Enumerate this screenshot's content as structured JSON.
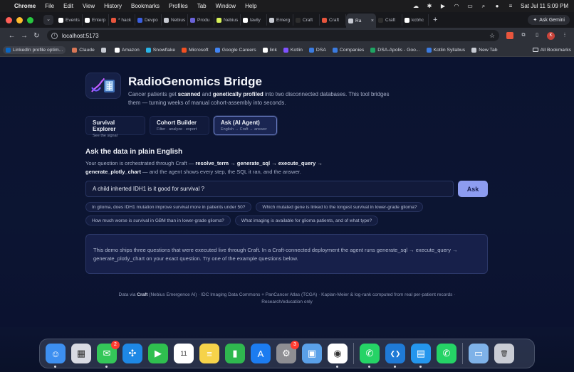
{
  "menubar": {
    "app": "Chrome",
    "items": [
      "File",
      "Edit",
      "View",
      "History",
      "Bookmarks",
      "Profiles",
      "Tab",
      "Window",
      "Help"
    ],
    "clock": "Sat Jul 11  5:09 PM"
  },
  "tabs": [
    {
      "label": "Events",
      "color": "#ffffff"
    },
    {
      "label": "Enterp",
      "color": "#ffffff"
    },
    {
      "label": "* hack",
      "color": "#e8553d"
    },
    {
      "label": "Devpo",
      "color": "#3b5fe0"
    },
    {
      "label": "Nebius",
      "color": "#c8cbd3"
    },
    {
      "label": "Produ",
      "color": "#6b63d9"
    },
    {
      "label": "Nebius",
      "color": "#d7f25a"
    },
    {
      "label": "tavily",
      "color": "#ffffff"
    },
    {
      "label": "Emerg",
      "color": "#c8cbd3"
    },
    {
      "label": "Craft",
      "color": "#2e2e2e"
    },
    {
      "label": "Craft",
      "color": "#e8553d"
    },
    {
      "label": "Ra",
      "color": "#c8cbd3",
      "active": true
    },
    {
      "label": "Craft",
      "color": "#2e2e2e"
    },
    {
      "label": "kcbhc",
      "color": "#ffffff"
    }
  ],
  "ask_gemini": "Ask Gemini",
  "address": {
    "url": "localhost:5173"
  },
  "bookmarks": [
    {
      "label": "LinkedIn profile optim...",
      "color": "#0a66c2"
    },
    {
      "label": "Claude",
      "color": "#d97757"
    },
    {
      "label": "",
      "color": "#c8cbd3"
    },
    {
      "label": "Amazon",
      "color": "#ffffff"
    },
    {
      "label": "Snowflake",
      "color": "#29b5e8"
    },
    {
      "label": "Microsoft",
      "color": "#f25022"
    },
    {
      "label": "Google Careers",
      "color": "#4285f4"
    },
    {
      "label": "link",
      "color": "#ffffff"
    },
    {
      "label": "Kotlin",
      "color": "#7f52ff"
    },
    {
      "label": "DSA",
      "color": "#3b7be0"
    },
    {
      "label": "Companies",
      "color": "#3b7be0"
    },
    {
      "label": "DSA-Apolis - Goo...",
      "color": "#1fa463"
    },
    {
      "label": "Kotlin Syllabus",
      "color": "#3b7be0"
    },
    {
      "label": "New Tab",
      "color": "#c8cbd3"
    }
  ],
  "all_bookmarks": "All Bookmarks",
  "hero": {
    "title": "RadioGenomics Bridge",
    "desc_1": "Cancer patients get ",
    "desc_b1": "scanned",
    "desc_2": " and ",
    "desc_b2": "genetically profiled",
    "desc_3": " into two disconnected databases. This tool bridges them — turning weeks of manual cohort-assembly into seconds."
  },
  "cards": [
    {
      "title": "Survival Explorer",
      "sub": "See the signal"
    },
    {
      "title": "Cohort Builder",
      "sub": "Filter · analyze · export"
    },
    {
      "title": "Ask (AI Agent)",
      "sub": "English → Craft → answer"
    }
  ],
  "ask_section": {
    "title": "Ask the data in plain English",
    "desc_1": "Your question is orchestrated through Craft — ",
    "desc_b1": "resolve_term → generate_sql → execute_query → generate_plotly_chart",
    "desc_2": " — and the agent shows every step, the SQL it ran, and the answer.",
    "query_value": "A child inherted IDH1 is it good for survival ?",
    "ask_label": "Ask"
  },
  "examples": [
    [
      "In glioma, does IDH1 mutation improve survival more in patients under 50?",
      "Which mutated gene is linked to the longest survival in lower-grade glioma?"
    ],
    [
      "How much worse is survival in GBM than in lower-grade glioma?",
      "What imaging is available for glioma patients, and of what type?"
    ]
  ],
  "info_text": "This demo ships three questions that were executed live through Craft. In a Craft-connected deployment the agent runs generate_sql → execute_query → generate_plotly_chart on your exact question. Try one of the example questions below.",
  "footer": {
    "pre": "Data via ",
    "bold": "Craft",
    "rest": " (Nebius Emergence AI) · IDC Imaging Data Commons + PanCancer Atlas (TCGA) · Kaplan-Meier & log-rank computed from real per-patient records · Research/education only"
  },
  "dock": [
    {
      "name": "finder-icon",
      "color": "#3d8ff0",
      "glyph": "☺",
      "dot": true
    },
    {
      "name": "launchpad-icon",
      "color": "#d9dbe3",
      "glyph": "▦",
      "dot": false
    },
    {
      "name": "messages-icon",
      "color": "#34c759",
      "glyph": "✉",
      "dot": true,
      "badge": "2"
    },
    {
      "name": "safari-icon",
      "color": "#1e88e5",
      "glyph": "✣",
      "dot": false
    },
    {
      "name": "facetime-icon",
      "color": "#2fbf4f",
      "glyph": "▶",
      "dot": false
    },
    {
      "name": "calendar-icon",
      "color": "#ffffff",
      "glyph": "11",
      "dot": false
    },
    {
      "name": "notes-icon",
      "color": "#f6d34a",
      "glyph": "≡",
      "dot": false
    },
    {
      "name": "numbers-icon",
      "color": "#2fb84f",
      "glyph": "▮",
      "dot": false
    },
    {
      "name": "app-store-icon",
      "color": "#1c7cf0",
      "glyph": "A",
      "dot": false
    },
    {
      "name": "system-settings-icon",
      "color": "#8e8e93",
      "glyph": "⚙",
      "dot": false,
      "badge": "3"
    },
    {
      "name": "preview-icon",
      "color": "#5aa0e8",
      "glyph": "▣",
      "dot": false
    },
    {
      "name": "chrome-icon",
      "color": "#ffffff",
      "glyph": "◉",
      "dot": true
    },
    {
      "name": "whatsapp-icon",
      "color": "#25d366",
      "glyph": "✆",
      "dot": true
    },
    {
      "name": "vscode-icon",
      "color": "#1f7ad6",
      "glyph": "❮❯",
      "dot": true
    },
    {
      "name": "docker-icon",
      "color": "#2496ed",
      "glyph": "▤",
      "dot": true
    },
    {
      "name": "whatsapp-beta-icon",
      "color": "#25d366",
      "glyph": "✆",
      "dot": false
    },
    {
      "name": "downloads-folder-icon",
      "color": "#7fb2e8",
      "glyph": "▭",
      "dot": false
    },
    {
      "name": "trash-icon",
      "color": "#c9ccd4",
      "glyph": "🗑",
      "dot": false
    }
  ]
}
